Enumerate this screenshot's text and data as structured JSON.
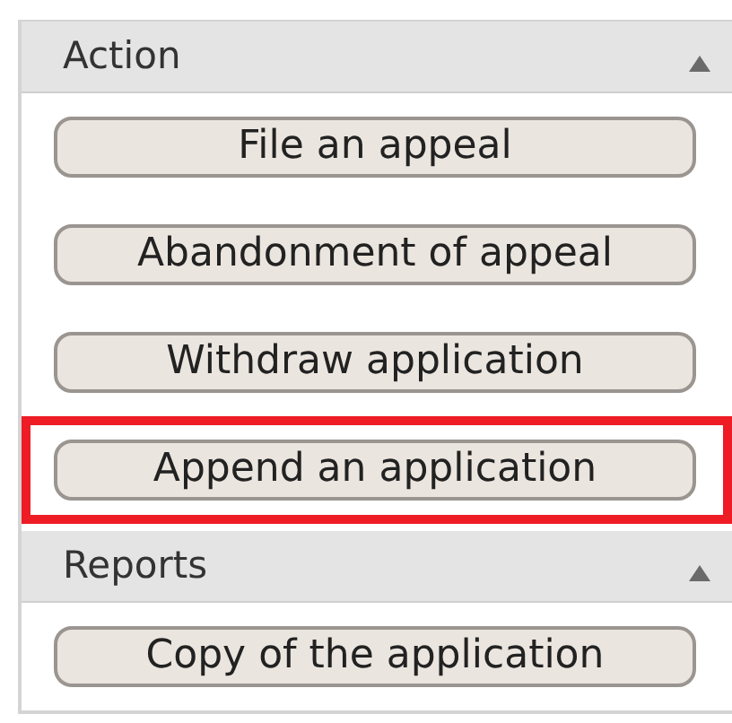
{
  "sections": [
    {
      "title": "Action",
      "expanded": true,
      "items": [
        {
          "label": "File an appeal",
          "highlighted": false
        },
        {
          "label": "Abandonment of appeal",
          "highlighted": false
        },
        {
          "label": "Withdraw application",
          "highlighted": false
        },
        {
          "label": "Append an application",
          "highlighted": true
        }
      ]
    },
    {
      "title": "Reports",
      "expanded": true,
      "items": [
        {
          "label": "Copy of the application",
          "highlighted": false
        }
      ]
    }
  ]
}
